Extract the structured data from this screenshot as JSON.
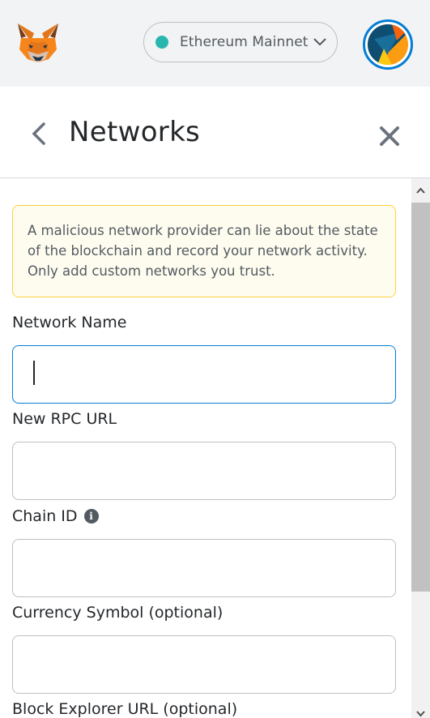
{
  "topbar": {
    "network": {
      "label": "Ethereum Mainnet",
      "dot_color": "#29b6af"
    }
  },
  "header": {
    "title": "Networks"
  },
  "warning": {
    "text": "A malicious network provider can lie about the state of the blockchain and record your network activity. Only add custom networks you trust."
  },
  "form": {
    "fields": [
      {
        "label": "Network Name",
        "value": ""
      },
      {
        "label": "New RPC URL",
        "value": ""
      },
      {
        "label": "Chain ID",
        "value": ""
      },
      {
        "label": "Currency Symbol (optional)",
        "value": ""
      },
      {
        "label": "Block Explorer URL (optional)",
        "value": ""
      }
    ],
    "chain_id_info_icon": "i"
  },
  "colors": {
    "accent": "#037dd6",
    "warning_border": "#ffd33d",
    "warning_bg": "#fefcef"
  },
  "icons": [
    "metamask-fox-logo",
    "chevron-down-icon",
    "account-avatar",
    "back-arrow-icon",
    "close-icon",
    "info-icon"
  ]
}
